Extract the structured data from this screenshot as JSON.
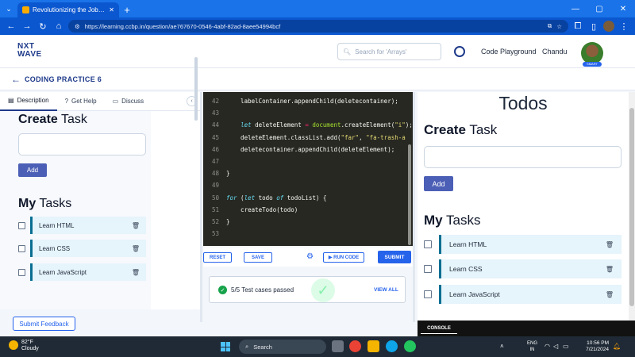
{
  "browser": {
    "tab_title": "Revolutionizing the Job Market",
    "url": "https://learning.ccbp.in/question/ae767670-0546-4abf-82ad-8aee54994bcf"
  },
  "header": {
    "logo_line1": "NXT",
    "logo_line2": "WAVE",
    "search_placeholder": "Search for 'Arrays'",
    "code_playground": "Code Playground",
    "user_name": "Chandu",
    "avatar_badge": "SMART"
  },
  "practice": {
    "title": "CODING PRACTICE 6"
  },
  "left_tabs": [
    {
      "label": "Description"
    },
    {
      "label": "Get Help"
    },
    {
      "label": "Discuss"
    }
  ],
  "left_app": {
    "create_bold": "Create",
    "create_rest": " Task",
    "add_label": "Add",
    "my_bold": "My",
    "my_rest": " Tasks",
    "tasks": [
      "Learn HTML",
      "Learn CSS",
      "Learn JavaScript"
    ]
  },
  "feedback_label": "Submit Feedback",
  "editor": {
    "lines": [
      {
        "n": "42",
        "code": "    labelContainer.appendChild(deletecontainer);"
      },
      {
        "n": "43",
        "code": ""
      },
      {
        "n": "44",
        "code": "    let deleteElement = document.createElement(\"i\");"
      },
      {
        "n": "45",
        "code": "    deleteElement.classList.add(\"far\", \"fa-trash-a"
      },
      {
        "n": "46",
        "code": "    deletecontainer.appendChild(deleteElement);"
      },
      {
        "n": "47",
        "code": ""
      },
      {
        "n": "48",
        "code": "}"
      },
      {
        "n": "49",
        "code": ""
      },
      {
        "n": "50",
        "code": "for (let todo of todoList) {"
      },
      {
        "n": "51",
        "code": "    createTodo(todo)"
      },
      {
        "n": "52",
        "code": "}"
      },
      {
        "n": "53",
        "code": ""
      }
    ],
    "reset": "RESET",
    "save": "SAVE",
    "run": "▶ RUN CODE",
    "submit": "SUBMIT"
  },
  "results": {
    "text": "5/5 Test cases passed",
    "view_all": "VIEW ALL"
  },
  "preview": {
    "title": "Todos",
    "create_bold": "Create",
    "create_rest": " Task",
    "add_label": "Add",
    "my_bold": "My",
    "my_rest": " Tasks",
    "tasks": [
      "Learn HTML",
      "Learn CSS",
      "Learn JavaScript"
    ],
    "console": "CONSOLE"
  },
  "taskbar": {
    "temp": "82°F",
    "weather": "Cloudy",
    "search": "Search",
    "lang1": "ENG",
    "lang2": "IN",
    "time": "10:56 PM",
    "date": "7/21/2024"
  },
  "colors": {
    "brand_blue": "#1e3a8a",
    "accent": "#2563eb",
    "add_button": "#4c5fb6",
    "task_card": "#e6f4fb",
    "task_border": "#096f92",
    "editor_bg": "#272822",
    "success": "#16a34a"
  }
}
